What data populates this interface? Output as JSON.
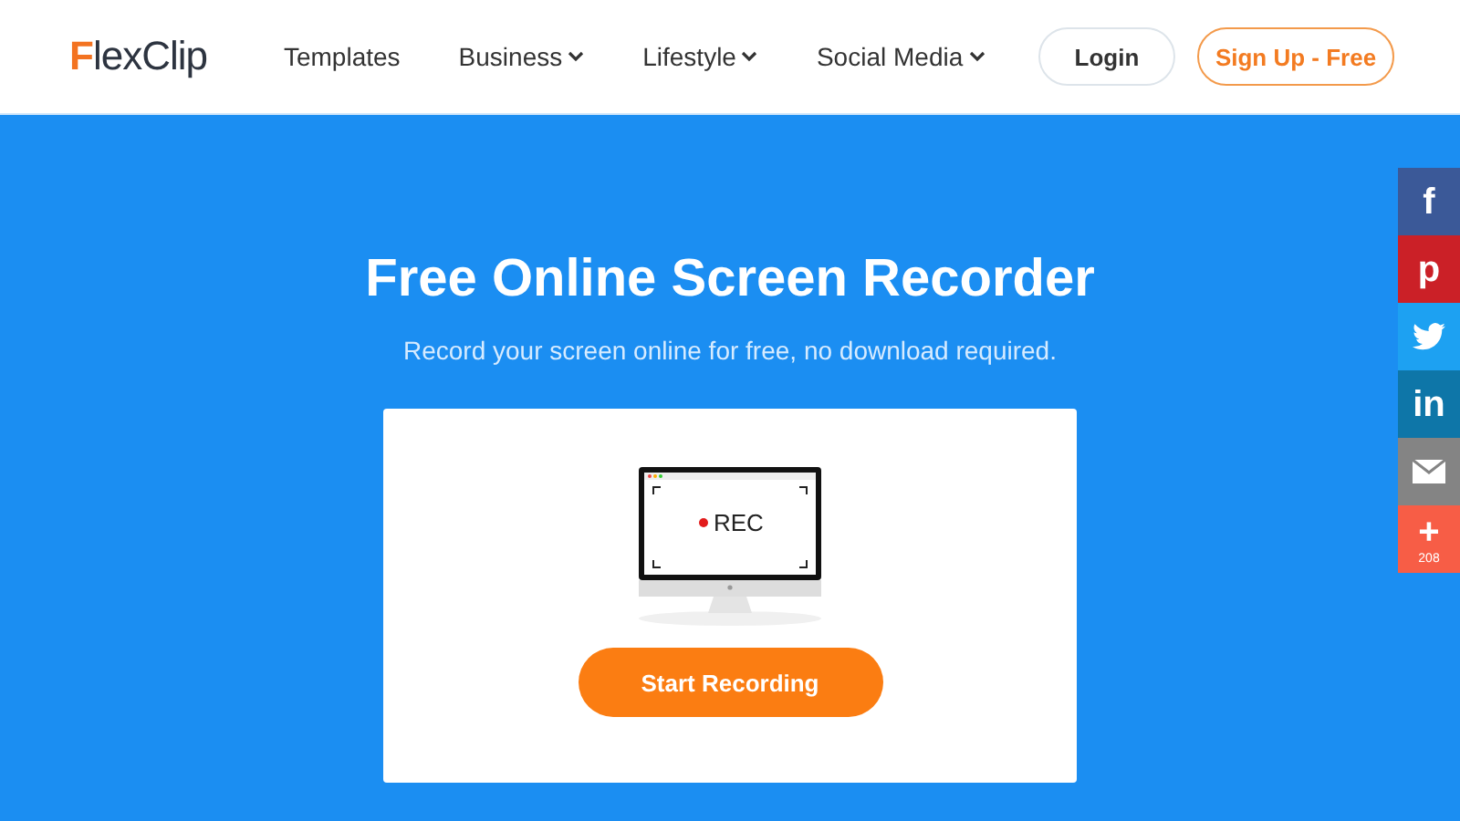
{
  "header": {
    "logo": "FlexClip",
    "nav": [
      {
        "label": "Templates",
        "dropdown": false
      },
      {
        "label": "Business",
        "dropdown": true
      },
      {
        "label": "Lifestyle",
        "dropdown": true
      },
      {
        "label": "Social Media",
        "dropdown": true
      }
    ],
    "buttons": [
      {
        "label": "Login",
        "kind": "plain"
      },
      {
        "label": "Sign Up - Free",
        "kind": "accent"
      }
    ]
  },
  "hero": {
    "title": "Free Online Screen Recorder",
    "subtitle": "Record your screen online for free, no download required.",
    "monitor_text": "REC",
    "button": "Start Recording"
  },
  "share": [
    {
      "kind": "facebook",
      "glyph": "f",
      "color": "#3b5998"
    },
    {
      "kind": "pinterest",
      "glyph": "p",
      "color": "#cb2027"
    },
    {
      "kind": "twitter",
      "color": "#1da1f2"
    },
    {
      "kind": "linkedin",
      "glyph": "in",
      "color": "#0e76a8"
    },
    {
      "kind": "email",
      "color": "#848484"
    },
    {
      "kind": "more",
      "glyph": "+",
      "count": "208",
      "color": "#f75d46"
    }
  ]
}
